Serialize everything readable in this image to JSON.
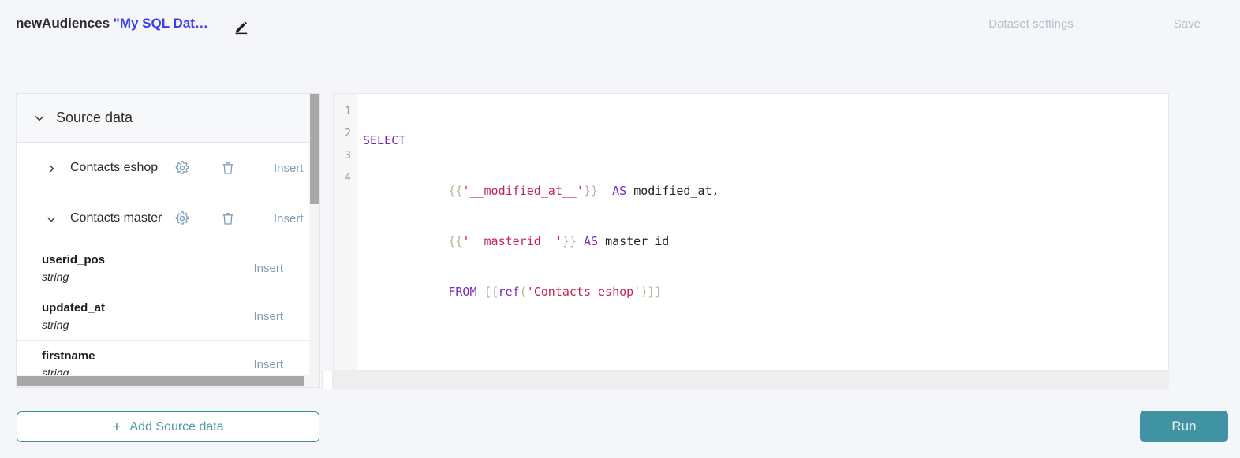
{
  "header": {
    "project_name": "newAudiences",
    "dataset_name": "\"My SQL Dat…",
    "edit_icon": "pencil-icon",
    "dataset_settings_label": "Dataset settings",
    "save_label": "Save"
  },
  "sidebar": {
    "section_title": "Source data",
    "collapse_icon": "chevron-down-icon",
    "sources": [
      {
        "name": "Contacts eshop",
        "expanded": false,
        "expand_icon": "chevron-right-icon",
        "settings_icon": "gear-icon",
        "delete_icon": "trash-icon",
        "insert_label": "Insert"
      },
      {
        "name": "Contacts master",
        "expanded": true,
        "expand_icon": "chevron-down-icon",
        "settings_icon": "gear-icon",
        "delete_icon": "trash-icon",
        "insert_label": "Insert"
      }
    ],
    "fields": [
      {
        "name": "userid_pos",
        "type": "string",
        "insert_label": "Insert"
      },
      {
        "name": "updated_at",
        "type": "string",
        "insert_label": "Insert"
      },
      {
        "name": "firstname",
        "type": "string",
        "insert_label": "Insert"
      }
    ]
  },
  "editor": {
    "line_numbers": [
      "1",
      "2",
      "3",
      "4"
    ],
    "lines": [
      "SELECT",
      "            {{'__modified_at__'}}  AS modified_at,",
      "            {{'__masterid__'}} AS master_id",
      "            FROM {{ref('Contacts eshop')}}"
    ]
  },
  "footer": {
    "add_source_label": "Add Source data",
    "add_source_icon": "plus-icon",
    "run_label": "Run"
  },
  "colors": {
    "page_bg": "#f4f6fa",
    "accent_teal": "#3f93a3",
    "link_blue": "#7f9db9",
    "dataset_name_blue": "#3b3bf0",
    "disabled_grey": "#b9bdc9"
  }
}
